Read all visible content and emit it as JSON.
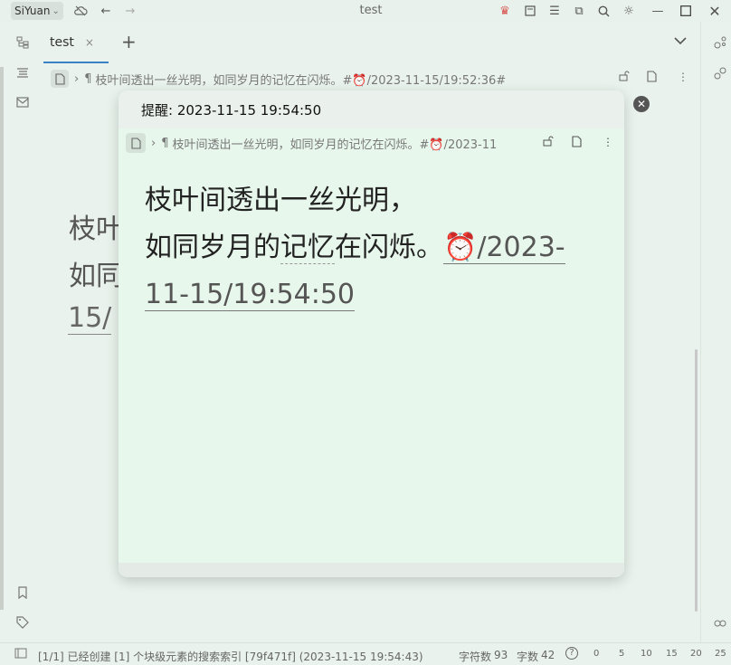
{
  "titlebar": {
    "app_name": "SiYuan",
    "window_title": "test",
    "icons": [
      "cloud-sync-icon",
      "back-arrow-icon",
      "forward-arrow-icon",
      "crown-icon",
      "readonly-icon",
      "menu-icon",
      "plugin-icon",
      "search-icon",
      "theme-icon",
      "minimize-icon",
      "maximize-icon",
      "close-icon"
    ]
  },
  "left_dock": {
    "icons": [
      "file-tree-icon",
      "outline-icon",
      "inbox-icon",
      "bookmark-icon",
      "tag-icon"
    ]
  },
  "right_dock": {
    "icons": [
      "graph-icon",
      "global-graph-icon",
      "backlink-icon"
    ]
  },
  "tabs": [
    {
      "label": "test",
      "close": "×",
      "active": true
    }
  ],
  "tab_add": "+",
  "editor": {
    "breadcrumb_mark": "¶",
    "breadcrumb_text": "枝叶间透出一丝光明，如同岁月的记忆在闪烁。#⏰/2023-11-15/19:52:36#",
    "background_lines": [
      "枝叶",
      "如同",
      "15/"
    ]
  },
  "popover": {
    "title": "提醒: 2023-11-15 19:54:50",
    "breadcrumb_mark": "¶",
    "breadcrumb_text": "枝叶间透出一丝光明，如同岁月的记忆在闪烁。#⏰/2023-11",
    "content": {
      "line1": "枝叶间透出一丝光明，",
      "line2_a": "如同岁月的",
      "line2_b": "记忆",
      "line2_c": "在闪烁。",
      "timestamp_a": "⏰/2023-",
      "timestamp_b": "11-15/19:54:50"
    }
  },
  "statusbar": {
    "message": "[1/1] 已经创建 [1] 个块级元素的搜索索引 [79f471f] (2023-11-15 19:54:43)",
    "char_count_label": "字符数",
    "char_count": "93",
    "word_count_label": "字数",
    "word_count": "42",
    "help": "?",
    "ruler": [
      "0",
      "5",
      "10",
      "15",
      "20",
      "25"
    ]
  },
  "colors": {
    "background": "#e9f2ec",
    "popover_bg": "#e8f7ec",
    "tab_accent": "#3b82c4",
    "crown": "#d9534f"
  }
}
